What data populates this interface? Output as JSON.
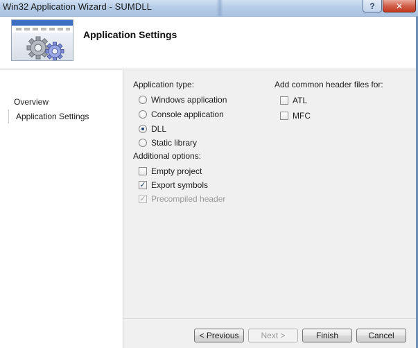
{
  "window": {
    "title": "Win32 Application Wizard - SUMDLL",
    "help_label": "?",
    "close_label": "✕"
  },
  "header": {
    "title": "Application Settings",
    "icon": "gears-icon"
  },
  "nav": {
    "items": [
      {
        "label": "Overview"
      },
      {
        "label": "Application Settings"
      }
    ],
    "active_index": 1
  },
  "application_type": {
    "label": "Application type:",
    "options": [
      {
        "label": "Windows application",
        "checked": false
      },
      {
        "label": "Console application",
        "checked": false
      },
      {
        "label": "DLL",
        "checked": true
      },
      {
        "label": "Static library",
        "checked": false
      }
    ]
  },
  "additional_options": {
    "label": "Additional options:",
    "options": [
      {
        "label": "Empty project",
        "checked": false,
        "enabled": true
      },
      {
        "label": "Export symbols",
        "checked": true,
        "enabled": true
      },
      {
        "label": "Precompiled header",
        "checked": true,
        "enabled": false
      }
    ]
  },
  "common_headers": {
    "label": "Add common header files for:",
    "options": [
      {
        "label": "ATL",
        "checked": false
      },
      {
        "label": "MFC",
        "checked": false
      }
    ]
  },
  "buttons": {
    "previous": "< Previous",
    "next": "Next >",
    "finish": "Finish",
    "cancel": "Cancel"
  },
  "colors": {
    "title_bar": "#b7cde7",
    "close_button": "#c1391f",
    "dialog_bg": "#f0f0f0",
    "radio_dot": "#1d3f73"
  }
}
